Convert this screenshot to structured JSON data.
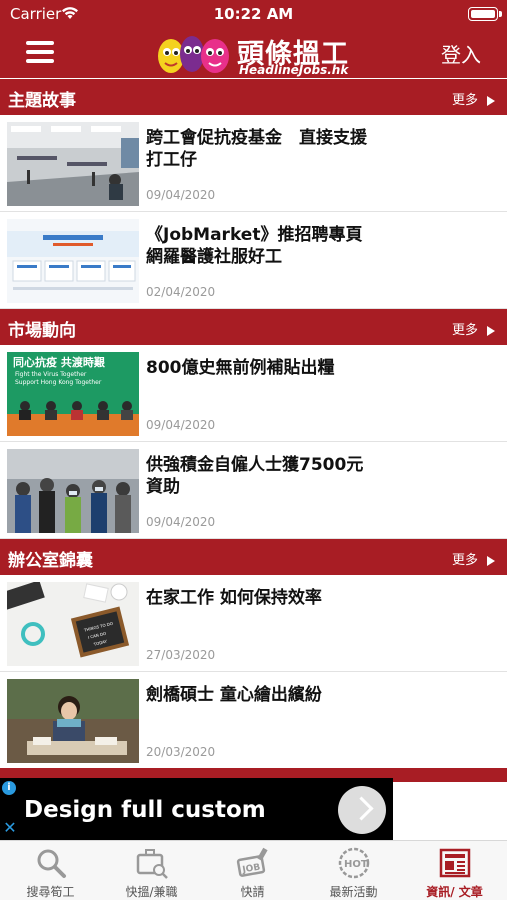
{
  "status": {
    "carrier": "Carrier",
    "time": "10:22 AM"
  },
  "header": {
    "logo_cn": "頭條搵工",
    "logo_en": "HeadlineJobs.hk",
    "login": "登入"
  },
  "sections": [
    {
      "title": "主題故事",
      "more": "更多",
      "items": [
        {
          "headline": "跨工會促抗疫基金　直接支援打工仔",
          "date": "09/04/2020"
        },
        {
          "headline": "《JobMarket》推招聘專頁 網羅醫護社服好工",
          "date": "02/04/2020"
        }
      ]
    },
    {
      "title": "市場動向",
      "more": "更多",
      "items": [
        {
          "headline": "800億史無前例補貼出糧",
          "date": "09/04/2020",
          "thumb_banner_cn": "同心抗疫 共渡時艱",
          "thumb_banner_en1": "Fight the Virus Together",
          "thumb_banner_en2": "Support Hong Kong Together"
        },
        {
          "headline": "供強積金自僱人士獲7500元資助",
          "date": "09/04/2020"
        }
      ]
    },
    {
      "title": "辦公室錦囊",
      "more": "更多",
      "items": [
        {
          "headline": "在家工作 如何保持效率",
          "date": "27/03/2020",
          "thumb_board1": "THINGS TO DO",
          "thumb_board2": "I CAN DO",
          "thumb_board3": "TODAY"
        },
        {
          "headline": "劍橋碩士 童心繪出繽紛",
          "date": "20/03/2020"
        }
      ]
    }
  ],
  "ad": {
    "text": "Design full custom"
  },
  "tabs": [
    {
      "label": "搜尋筍工",
      "icon": "magnifier-icon"
    },
    {
      "label": "快搵/兼職",
      "icon": "briefcase-search-icon"
    },
    {
      "label": "快請",
      "icon": "job-stamp-icon"
    },
    {
      "label": "最新活動",
      "icon": "hot-badge-icon"
    },
    {
      "label": "資訊/ 文章",
      "icon": "newspaper-icon",
      "active": true
    }
  ],
  "colors": {
    "brand": "#a81d24",
    "date": "#9a9a9a",
    "tab_inactive": "#555555"
  }
}
